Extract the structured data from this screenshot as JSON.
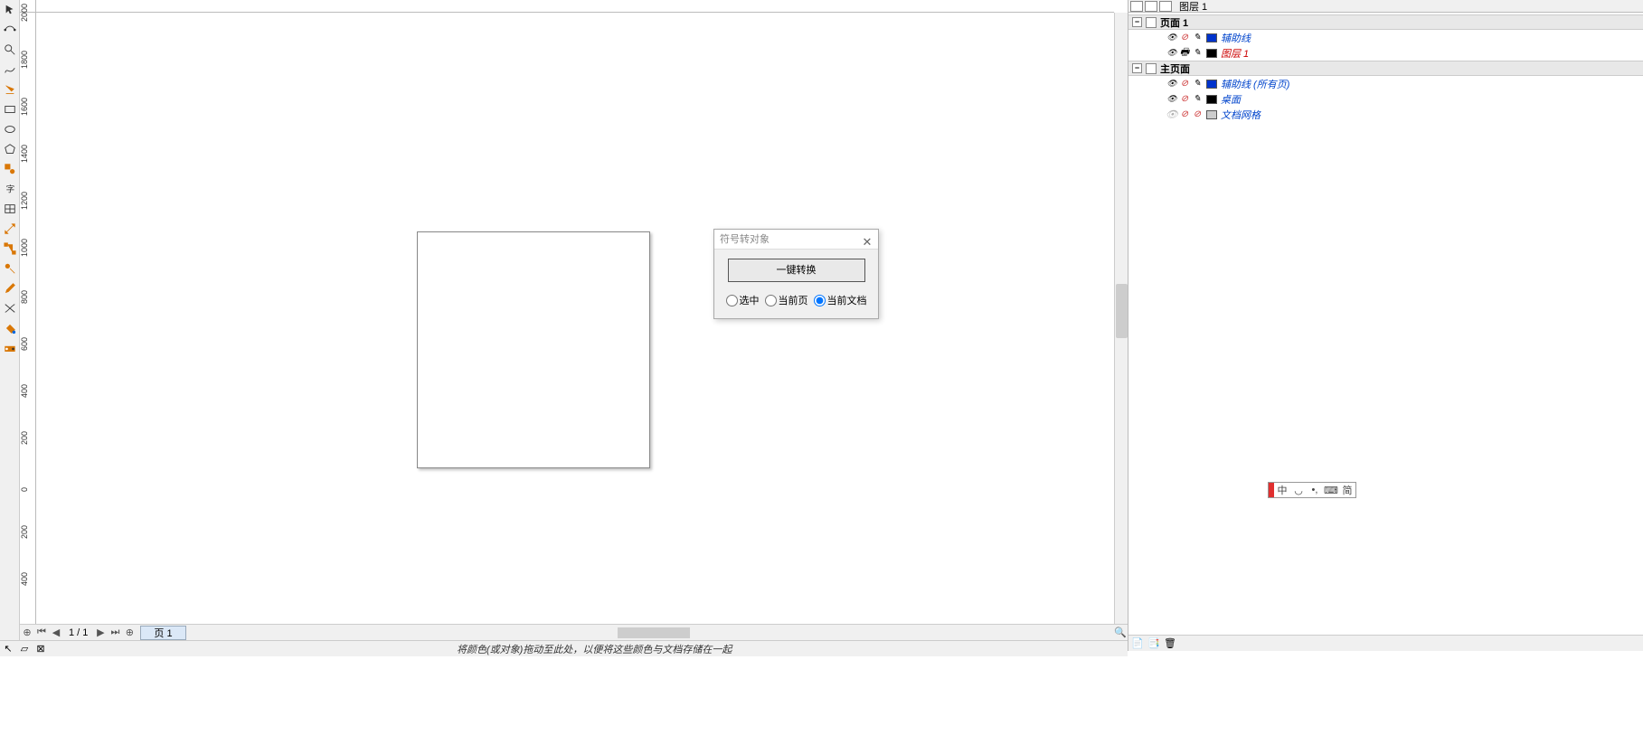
{
  "ruler": {
    "vticks": [
      "2000",
      "1800",
      "1600",
      "1400",
      "1200",
      "1000",
      "800",
      "600",
      "400",
      "200",
      "0",
      "200",
      "400"
    ]
  },
  "dialog": {
    "title": "符号转对象",
    "button": "一键转换",
    "opt1": "选中",
    "opt2": "当前页",
    "opt3": "当前文档"
  },
  "pagenav": {
    "counter": "1 / 1",
    "tab": "页 1"
  },
  "status": {
    "hint": "将颜色(或对象)拖动至此处，以便将这些颜色与文档存储在一起"
  },
  "panel": {
    "header_label": "图层 1",
    "page1": "页面 1",
    "page1_guides": "辅助线",
    "page1_layer1": "图层 1",
    "master": "主页面",
    "master_guides": "辅助线 (所有页)",
    "master_desktop": "桌面",
    "master_grid": "文档网格"
  },
  "ime": {
    "t1": "中",
    "t2": "简"
  }
}
